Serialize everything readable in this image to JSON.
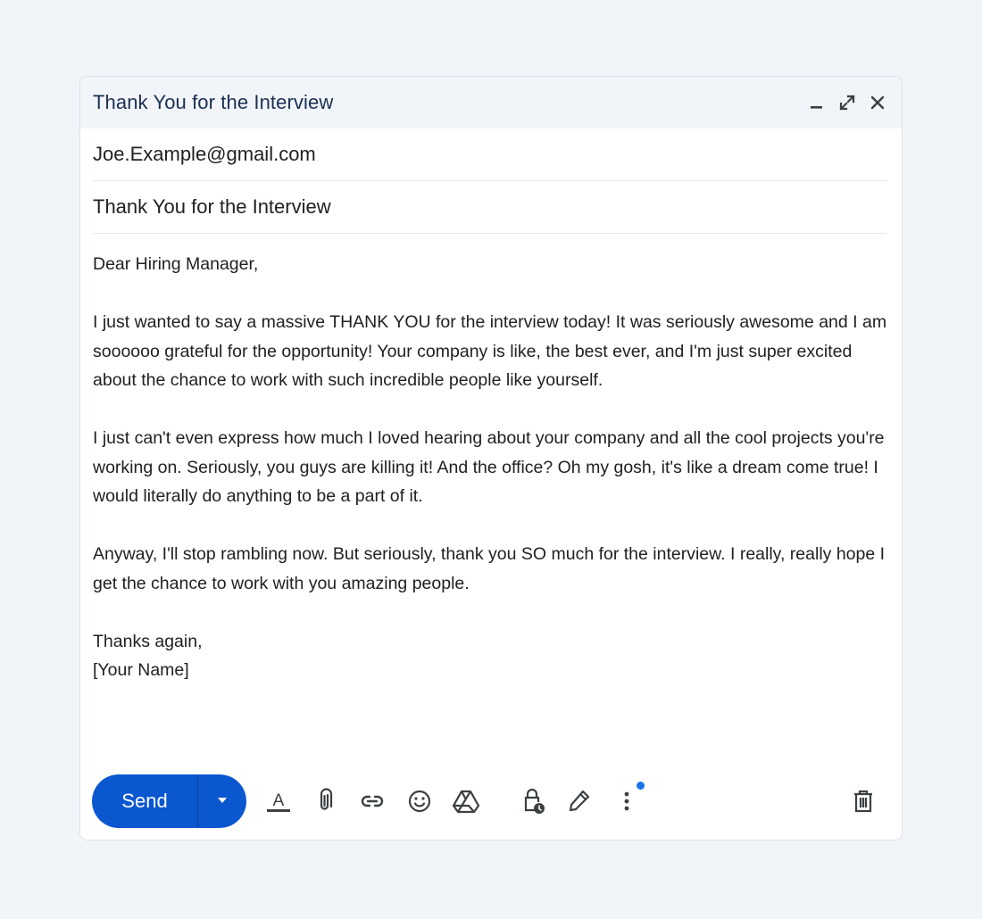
{
  "window": {
    "title": "Thank You for the Interview",
    "controls": [
      "minimize-icon",
      "expand-icon",
      "close-icon"
    ]
  },
  "recipient": {
    "value": "Joe.Example@gmail.com"
  },
  "subject": {
    "value": "Thank You for the Interview"
  },
  "body": {
    "greeting": "Dear Hiring Manager,",
    "paragraphs": [
      "I just wanted to say a massive THANK YOU for the interview today! It was seriously awesome and I am soooooo grateful for the opportunity! Your company is like, the best ever, and I'm just super excited about the chance to work with such incredible people like yourself.",
      "I just can't even express how much I loved hearing about your company and all the cool projects you're working on. Seriously, you guys are killing it! And the office? Oh my gosh, it's like a dream come true! I would literally do anything to be a part of it.",
      "Anyway, I'll stop rambling now. But seriously, thank you SO much for the interview. I really, really hope I get the chance to work with you amazing people."
    ],
    "closing": "Thanks again,",
    "signature": "[Your Name]"
  },
  "toolbar": {
    "send_label": "Send",
    "icons": [
      "send-options-icon",
      "text-format-icon",
      "attach-icon",
      "link-icon",
      "emoji-icon",
      "drive-icon",
      "confidential-mode-icon",
      "signature-icon",
      "more-options-icon",
      "discard-icon"
    ],
    "accent_color": "#0b57d0",
    "notification_dot_color": "#1a73e8"
  }
}
